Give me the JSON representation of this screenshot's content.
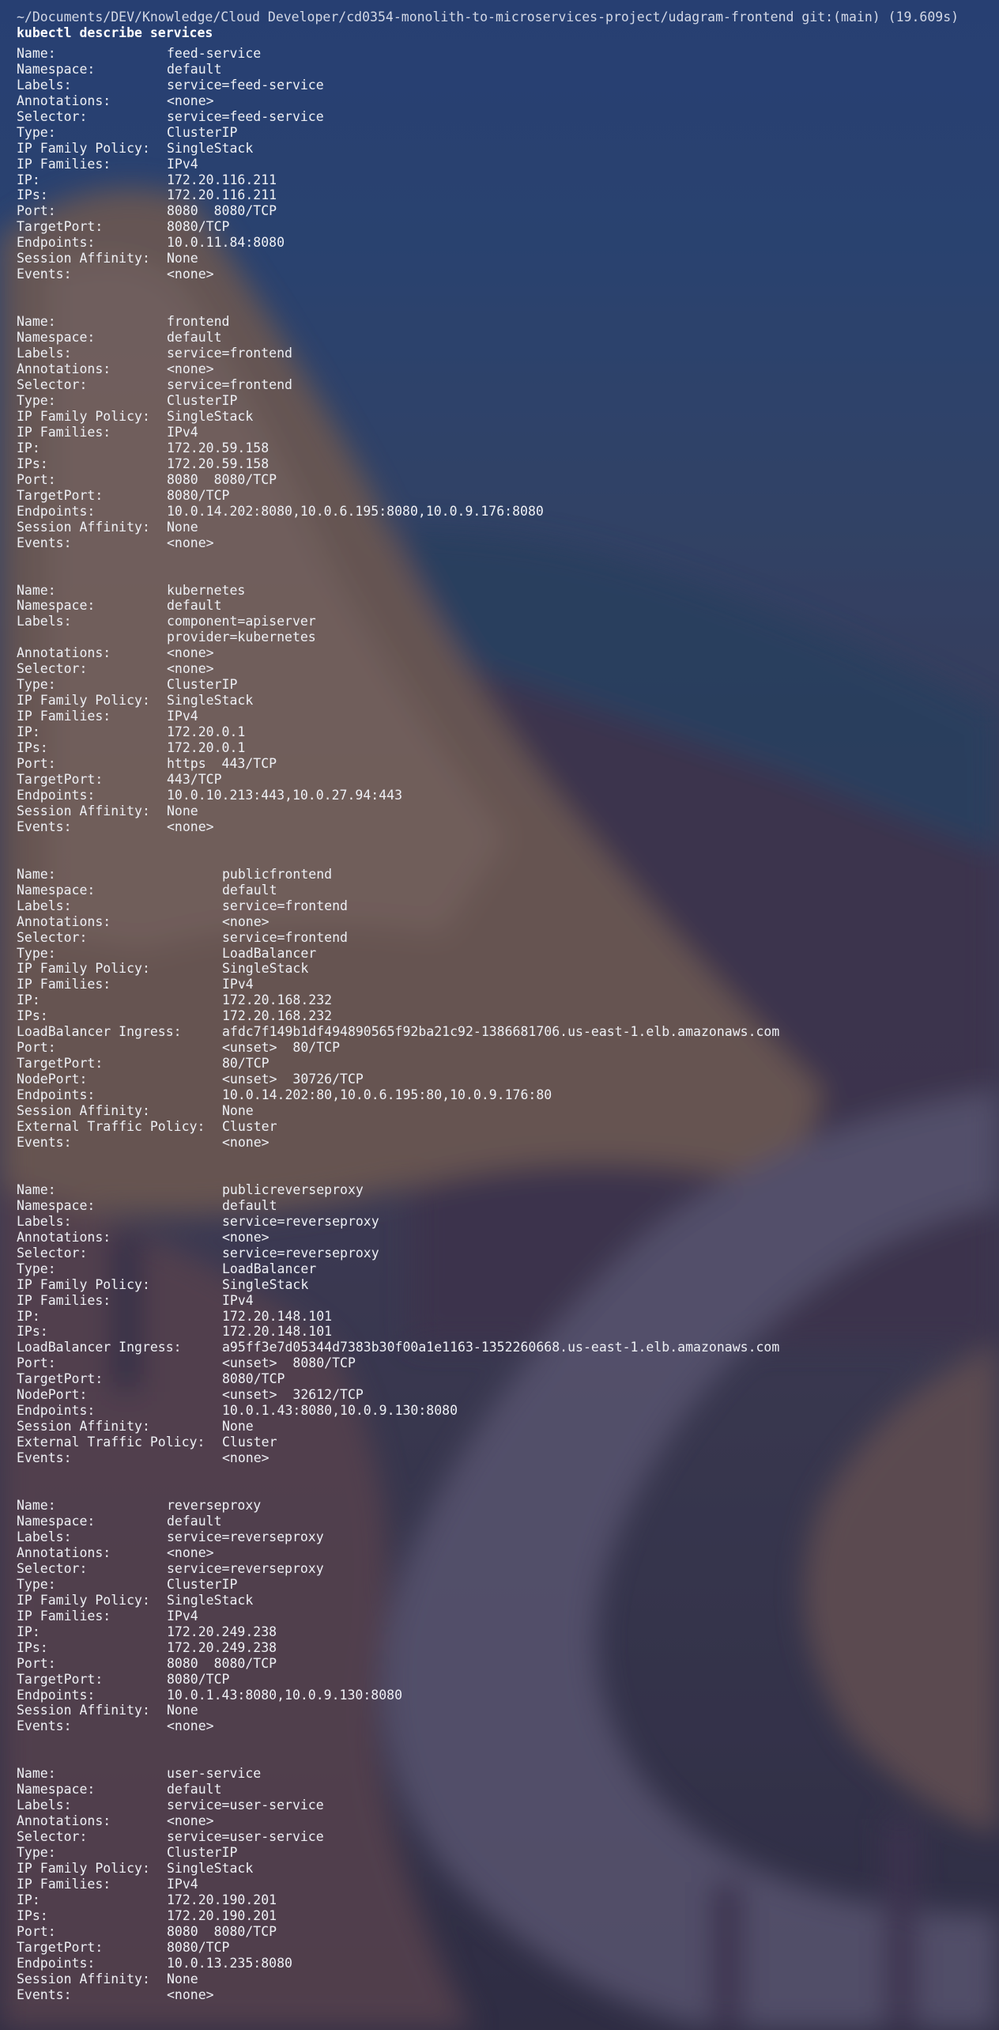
{
  "terminal": {
    "prompt": "~/Documents/DEV/Knowledge/Cloud Developer/cd0354-monolith-to-microservices-project/udagram-frontend git:(main) (19.609s)",
    "command": "kubectl describe services"
  },
  "services": [
    {
      "layout": "w1",
      "rows": [
        {
          "k": "Name:",
          "v": "feed-service"
        },
        {
          "k": "Namespace:",
          "v": "default"
        },
        {
          "k": "Labels:",
          "v": "service=feed-service"
        },
        {
          "k": "Annotations:",
          "v": "<none>"
        },
        {
          "k": "Selector:",
          "v": "service=feed-service"
        },
        {
          "k": "Type:",
          "v": "ClusterIP"
        },
        {
          "k": "IP Family Policy:",
          "v": "SingleStack"
        },
        {
          "k": "IP Families:",
          "v": "IPv4"
        },
        {
          "k": "IP:",
          "v": "172.20.116.211"
        },
        {
          "k": "IPs:",
          "v": "172.20.116.211"
        },
        {
          "k": "Port:",
          "v": "8080  8080/TCP"
        },
        {
          "k": "TargetPort:",
          "v": "8080/TCP"
        },
        {
          "k": "Endpoints:",
          "v": "10.0.11.84:8080"
        },
        {
          "k": "Session Affinity:",
          "v": "None"
        },
        {
          "k": "Events:",
          "v": "<none>"
        }
      ]
    },
    {
      "layout": "w1",
      "rows": [
        {
          "k": "Name:",
          "v": "frontend"
        },
        {
          "k": "Namespace:",
          "v": "default"
        },
        {
          "k": "Labels:",
          "v": "service=frontend"
        },
        {
          "k": "Annotations:",
          "v": "<none>"
        },
        {
          "k": "Selector:",
          "v": "service=frontend"
        },
        {
          "k": "Type:",
          "v": "ClusterIP"
        },
        {
          "k": "IP Family Policy:",
          "v": "SingleStack"
        },
        {
          "k": "IP Families:",
          "v": "IPv4"
        },
        {
          "k": "IP:",
          "v": "172.20.59.158"
        },
        {
          "k": "IPs:",
          "v": "172.20.59.158"
        },
        {
          "k": "Port:",
          "v": "8080  8080/TCP"
        },
        {
          "k": "TargetPort:",
          "v": "8080/TCP"
        },
        {
          "k": "Endpoints:",
          "v": "10.0.14.202:8080,10.0.6.195:8080,10.0.9.176:8080"
        },
        {
          "k": "Session Affinity:",
          "v": "None"
        },
        {
          "k": "Events:",
          "v": "<none>"
        }
      ]
    },
    {
      "layout": "w1",
      "rows": [
        {
          "k": "Name:",
          "v": "kubernetes"
        },
        {
          "k": "Namespace:",
          "v": "default"
        },
        {
          "k": "Labels:",
          "v": "component=apiserver"
        },
        {
          "k": "",
          "v": "provider=kubernetes"
        },
        {
          "k": "Annotations:",
          "v": "<none>"
        },
        {
          "k": "Selector:",
          "v": "<none>"
        },
        {
          "k": "Type:",
          "v": "ClusterIP"
        },
        {
          "k": "IP Family Policy:",
          "v": "SingleStack"
        },
        {
          "k": "IP Families:",
          "v": "IPv4"
        },
        {
          "k": "IP:",
          "v": "172.20.0.1"
        },
        {
          "k": "IPs:",
          "v": "172.20.0.1"
        },
        {
          "k": "Port:",
          "v": "https  443/TCP"
        },
        {
          "k": "TargetPort:",
          "v": "443/TCP"
        },
        {
          "k": "Endpoints:",
          "v": "10.0.10.213:443,10.0.27.94:443"
        },
        {
          "k": "Session Affinity:",
          "v": "None"
        },
        {
          "k": "Events:",
          "v": "<none>"
        }
      ]
    },
    {
      "layout": "w2",
      "rows": [
        {
          "k": "Name:",
          "v": "publicfrontend"
        },
        {
          "k": "Namespace:",
          "v": "default"
        },
        {
          "k": "Labels:",
          "v": "service=frontend"
        },
        {
          "k": "Annotations:",
          "v": "<none>"
        },
        {
          "k": "Selector:",
          "v": "service=frontend"
        },
        {
          "k": "Type:",
          "v": "LoadBalancer"
        },
        {
          "k": "IP Family Policy:",
          "v": "SingleStack"
        },
        {
          "k": "IP Families:",
          "v": "IPv4"
        },
        {
          "k": "IP:",
          "v": "172.20.168.232"
        },
        {
          "k": "IPs:",
          "v": "172.20.168.232"
        },
        {
          "k": "LoadBalancer Ingress:",
          "v": "afdc7f149b1df494890565f92ba21c92-1386681706.us-east-1.elb.amazonaws.com"
        },
        {
          "k": "Port:",
          "v": "<unset>  80/TCP"
        },
        {
          "k": "TargetPort:",
          "v": "80/TCP"
        },
        {
          "k": "NodePort:",
          "v": "<unset>  30726/TCP"
        },
        {
          "k": "Endpoints:",
          "v": "10.0.14.202:80,10.0.6.195:80,10.0.9.176:80"
        },
        {
          "k": "Session Affinity:",
          "v": "None"
        },
        {
          "k": "External Traffic Policy:",
          "v": "Cluster"
        },
        {
          "k": "Events:",
          "v": "<none>"
        }
      ]
    },
    {
      "layout": "w2",
      "rows": [
        {
          "k": "Name:",
          "v": "publicreverseproxy"
        },
        {
          "k": "Namespace:",
          "v": "default"
        },
        {
          "k": "Labels:",
          "v": "service=reverseproxy"
        },
        {
          "k": "Annotations:",
          "v": "<none>"
        },
        {
          "k": "Selector:",
          "v": "service=reverseproxy"
        },
        {
          "k": "Type:",
          "v": "LoadBalancer"
        },
        {
          "k": "IP Family Policy:",
          "v": "SingleStack"
        },
        {
          "k": "IP Families:",
          "v": "IPv4"
        },
        {
          "k": "IP:",
          "v": "172.20.148.101"
        },
        {
          "k": "IPs:",
          "v": "172.20.148.101"
        },
        {
          "k": "LoadBalancer Ingress:",
          "v": "a95ff3e7d05344d7383b30f00a1e1163-1352260668.us-east-1.elb.amazonaws.com"
        },
        {
          "k": "Port:",
          "v": "<unset>  8080/TCP"
        },
        {
          "k": "TargetPort:",
          "v": "8080/TCP"
        },
        {
          "k": "NodePort:",
          "v": "<unset>  32612/TCP"
        },
        {
          "k": "Endpoints:",
          "v": "10.0.1.43:8080,10.0.9.130:8080"
        },
        {
          "k": "Session Affinity:",
          "v": "None"
        },
        {
          "k": "External Traffic Policy:",
          "v": "Cluster"
        },
        {
          "k": "Events:",
          "v": "<none>"
        }
      ]
    },
    {
      "layout": "w1",
      "rows": [
        {
          "k": "Name:",
          "v": "reverseproxy"
        },
        {
          "k": "Namespace:",
          "v": "default"
        },
        {
          "k": "Labels:",
          "v": "service=reverseproxy"
        },
        {
          "k": "Annotations:",
          "v": "<none>"
        },
        {
          "k": "Selector:",
          "v": "service=reverseproxy"
        },
        {
          "k": "Type:",
          "v": "ClusterIP"
        },
        {
          "k": "IP Family Policy:",
          "v": "SingleStack"
        },
        {
          "k": "IP Families:",
          "v": "IPv4"
        },
        {
          "k": "IP:",
          "v": "172.20.249.238"
        },
        {
          "k": "IPs:",
          "v": "172.20.249.238"
        },
        {
          "k": "Port:",
          "v": "8080  8080/TCP"
        },
        {
          "k": "TargetPort:",
          "v": "8080/TCP"
        },
        {
          "k": "Endpoints:",
          "v": "10.0.1.43:8080,10.0.9.130:8080"
        },
        {
          "k": "Session Affinity:",
          "v": "None"
        },
        {
          "k": "Events:",
          "v": "<none>"
        }
      ]
    },
    {
      "layout": "w1",
      "rows": [
        {
          "k": "Name:",
          "v": "user-service"
        },
        {
          "k": "Namespace:",
          "v": "default"
        },
        {
          "k": "Labels:",
          "v": "service=user-service"
        },
        {
          "k": "Annotations:",
          "v": "<none>"
        },
        {
          "k": "Selector:",
          "v": "service=user-service"
        },
        {
          "k": "Type:",
          "v": "ClusterIP"
        },
        {
          "k": "IP Family Policy:",
          "v": "SingleStack"
        },
        {
          "k": "IP Families:",
          "v": "IPv4"
        },
        {
          "k": "IP:",
          "v": "172.20.190.201"
        },
        {
          "k": "IPs:",
          "v": "172.20.190.201"
        },
        {
          "k": "Port:",
          "v": "8080  8080/TCP"
        },
        {
          "k": "TargetPort:",
          "v": "8080/TCP"
        },
        {
          "k": "Endpoints:",
          "v": "10.0.13.235:8080"
        },
        {
          "k": "Session Affinity:",
          "v": "None"
        },
        {
          "k": "Events:",
          "v": "<none>"
        }
      ]
    }
  ]
}
